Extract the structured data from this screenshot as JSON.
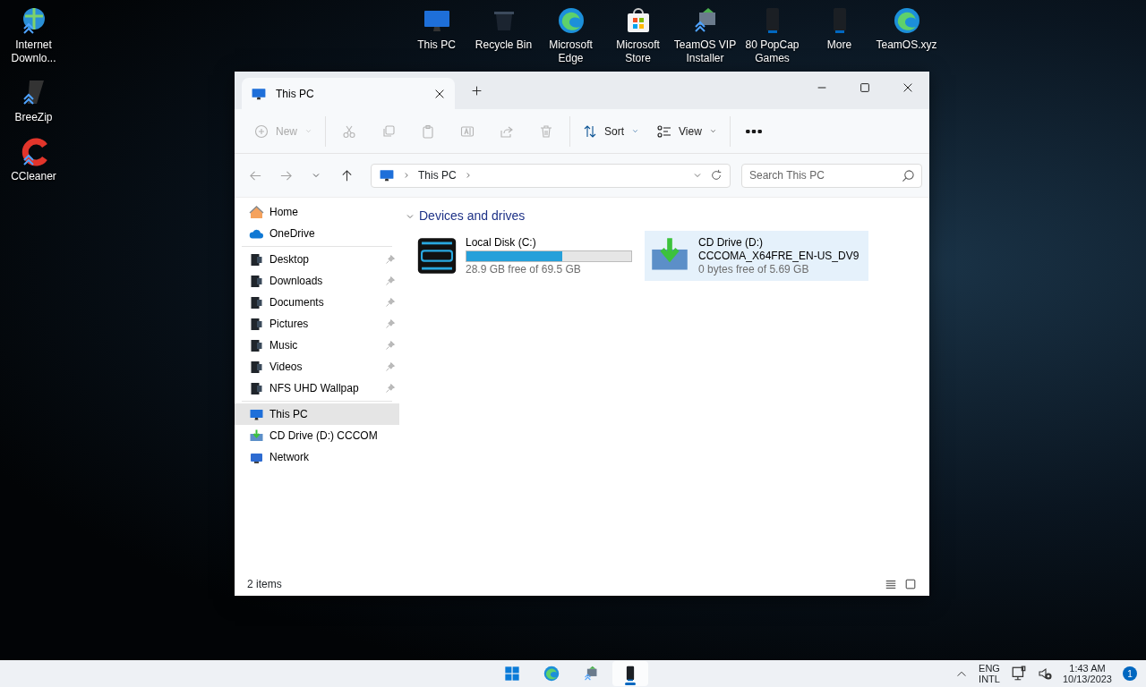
{
  "desktop": {
    "left_icons": [
      {
        "label": "Internet Downlo...",
        "kind": "globe-down"
      },
      {
        "label": "BreeZip",
        "kind": "zip"
      },
      {
        "label": "CCleaner",
        "kind": "ccleaner"
      }
    ],
    "top_icons": [
      {
        "label": "This PC",
        "kind": "monitor"
      },
      {
        "label": "Recycle Bin",
        "kind": "bin"
      },
      {
        "label": "Microsoft Edge",
        "kind": "edge"
      },
      {
        "label": "Microsoft Store",
        "kind": "store"
      },
      {
        "label": "TeamOS VIP Installer",
        "kind": "installer"
      },
      {
        "label": "80 PopCap Games",
        "kind": "tower"
      },
      {
        "label": "More",
        "kind": "tower"
      },
      {
        "label": "TeamOS.xyz",
        "kind": "edge"
      }
    ]
  },
  "window": {
    "tabs": [
      {
        "label": "This PC",
        "selected": true
      }
    ],
    "toolbar": [
      [
        {
          "kind": "new",
          "label": "New",
          "disabled": true,
          "dropdown": true
        }
      ],
      [
        {
          "kind": "cut",
          "disabled": true
        },
        {
          "kind": "copy",
          "disabled": true
        },
        {
          "kind": "paste",
          "disabled": true
        },
        {
          "kind": "rename",
          "disabled": true
        },
        {
          "kind": "share",
          "disabled": true
        },
        {
          "kind": "delete",
          "disabled": true
        }
      ],
      [
        {
          "kind": "sort",
          "label": "Sort",
          "disabled": false,
          "dropdown": true
        },
        {
          "kind": "view",
          "label": "View",
          "disabled": false,
          "dropdown": true
        }
      ],
      [
        {
          "kind": "more",
          "disabled": false
        }
      ]
    ],
    "nav_buttons": [
      {
        "kind": "back",
        "disabled": true
      },
      {
        "kind": "forward",
        "disabled": true
      },
      {
        "kind": "history",
        "disabled": false
      },
      {
        "kind": "up",
        "disabled": false
      }
    ],
    "address": {
      "crumbs": [
        "This PC"
      ]
    },
    "search": {
      "placeholder": "Search This PC"
    },
    "sidebar": [
      [
        {
          "label": "Home",
          "kind": "home",
          "pinned": false,
          "selected": false
        },
        {
          "label": "OneDrive",
          "kind": "cloud",
          "pinned": false,
          "selected": false
        }
      ],
      [
        {
          "label": "Desktop",
          "kind": "folder",
          "pinned": true,
          "selected": false
        },
        {
          "label": "Downloads",
          "kind": "folder",
          "pinned": true,
          "selected": false
        },
        {
          "label": "Documents",
          "kind": "folder",
          "pinned": true,
          "selected": false
        },
        {
          "label": "Pictures",
          "kind": "folder",
          "pinned": true,
          "selected": false
        },
        {
          "label": "Music",
          "kind": "folder",
          "pinned": true,
          "selected": false
        },
        {
          "label": "Videos",
          "kind": "folder",
          "pinned": true,
          "selected": false
        },
        {
          "label": "NFS UHD Wallpap",
          "kind": "folder",
          "pinned": true,
          "selected": false
        }
      ],
      [
        {
          "label": "This PC",
          "kind": "monitor",
          "pinned": false,
          "selected": true
        },
        {
          "label": "CD Drive (D:) CCCOM",
          "kind": "cd",
          "pinned": false,
          "selected": false
        },
        {
          "label": "Network",
          "kind": "network",
          "pinned": false,
          "selected": false
        }
      ]
    ],
    "section": {
      "title": "Devices and drives",
      "expanded": true
    },
    "drives": [
      {
        "name": "Local Disk (C:)",
        "kind": "hdd",
        "level": 0.58,
        "free": "28.9 GB free of 69.5 GB",
        "selected": false
      },
      {
        "name": "CD Drive (D:)",
        "volume": "CCCOMA_X64FRE_EN-US_DV9",
        "kind": "cd",
        "free": "0 bytes free of 5.69 GB",
        "selected": true
      }
    ],
    "status_bar": {
      "count": "2 items"
    }
  },
  "taskbar": {
    "apps": [
      {
        "kind": "start",
        "active": false
      },
      {
        "kind": "edge",
        "active": false
      },
      {
        "kind": "installer",
        "active": false
      },
      {
        "kind": "tower",
        "active": true
      }
    ],
    "language": [
      "ENG",
      "INTL"
    ],
    "time": "1:43 AM",
    "date": "10/13/2023",
    "notifications": "1"
  }
}
